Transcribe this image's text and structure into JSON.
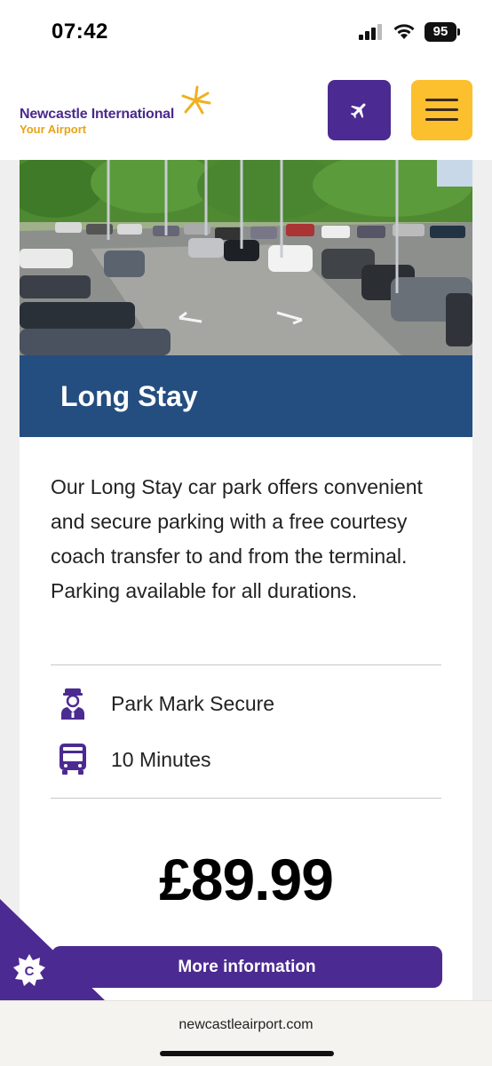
{
  "status_bar": {
    "time": "07:42",
    "battery": "95",
    "icons": [
      "signal-icon",
      "wifi-icon",
      "battery-icon"
    ]
  },
  "header": {
    "logo_name": "Newcastle International",
    "logo_tagline": "Your Airport",
    "flight_button_icon": "airplane-icon",
    "menu_button_icon": "hamburger-menu-icon",
    "colors": {
      "purple": "#4b2b91",
      "yellow": "#fcbf2e"
    }
  },
  "card": {
    "title": "Long Stay",
    "description": "Our Long Stay car park offers convenient and secure parking with a free courtesy coach transfer to and from the terminal. Parking available for all durations.",
    "features": [
      {
        "icon": "security-guard-icon",
        "label": "Park Mark Secure"
      },
      {
        "icon": "bus-icon",
        "label": "10 Minutes"
      }
    ],
    "price": "£89.99",
    "cta_label": "More information",
    "colors": {
      "title_bar": "#244e80"
    }
  },
  "cookie_badge": {
    "letter": "C",
    "icon": "cookie-settings-icon"
  },
  "browser": {
    "url": "newcastleairport.com"
  }
}
